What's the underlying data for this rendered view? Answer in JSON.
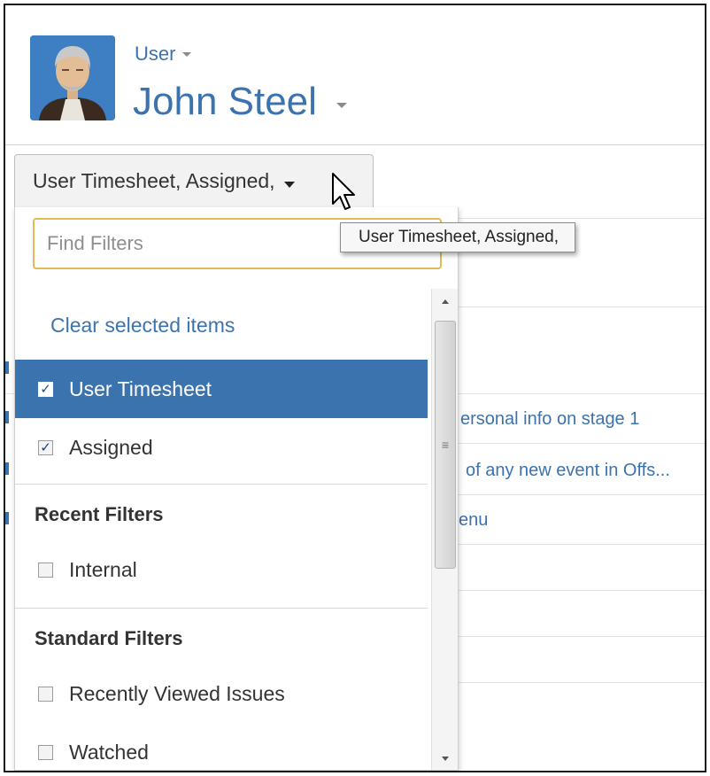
{
  "header": {
    "user_type": "User",
    "user_name": "John Steel"
  },
  "filter_trigger": {
    "label": "User Timesheet, Assigned,"
  },
  "tooltip": {
    "text": "User Timesheet,  Assigned,"
  },
  "dropdown": {
    "search_placeholder": "Find Filters",
    "clear_label": "Clear selected items",
    "selected_items": [
      {
        "label": "User Timesheet",
        "checked": true,
        "highlighted": true
      },
      {
        "label": "Assigned",
        "checked": true,
        "highlighted": false
      }
    ],
    "recent": {
      "title": "Recent Filters",
      "items": [
        {
          "label": "Internal",
          "checked": false
        }
      ]
    },
    "standard": {
      "title": "Standard Filters",
      "items": [
        {
          "label": "Recently Viewed Issues",
          "checked": false
        },
        {
          "label": "Watched",
          "checked": false
        }
      ]
    }
  },
  "background_list": {
    "items": [
      "ersonal info on stage 1",
      "of any new event in Offs...",
      "enu"
    ]
  },
  "colors": {
    "accent": "#3b73af",
    "input_focus": "#e7b956",
    "checkbox_check": "#1f3c6e"
  }
}
